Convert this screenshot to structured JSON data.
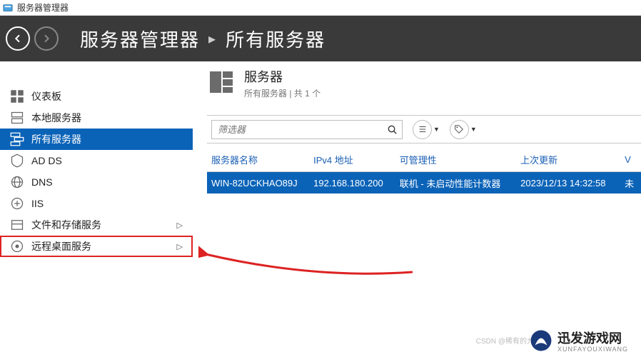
{
  "titlebar": {
    "title": "服务器管理器"
  },
  "header": {
    "breadcrumb": {
      "part1": "服务器管理器",
      "sep": "▸",
      "part2": "所有服务器"
    }
  },
  "sidebar": {
    "items": [
      {
        "label": "仪表板",
        "icon": "dashboard"
      },
      {
        "label": "本地服务器",
        "icon": "local-server"
      },
      {
        "label": "所有服务器",
        "icon": "all-servers",
        "selected": true
      },
      {
        "label": "AD DS",
        "icon": "ad-ds"
      },
      {
        "label": "DNS",
        "icon": "dns"
      },
      {
        "label": "IIS",
        "icon": "iis"
      },
      {
        "label": "文件和存储服务",
        "icon": "file-storage",
        "chevron": "▷"
      },
      {
        "label": "远程桌面服务",
        "icon": "remote-desktop",
        "chevron": "▷",
        "boxed": true
      }
    ]
  },
  "panel": {
    "title": "服务器",
    "subtitle": "所有服务器 | 共 1 个"
  },
  "toolbar": {
    "filter_placeholder": "筛选器"
  },
  "grid": {
    "headers": {
      "c1": "服务器名称",
      "c2": "IPv4 地址",
      "c3": "可管理性",
      "c4": "上次更新",
      "c5": "V"
    },
    "rows": [
      {
        "c1": "WIN-82UCKHAO89J",
        "c2": "192.168.180.200",
        "c3": "联机 - 未启动性能计数器",
        "c4": "2023/12/13 14:32:58",
        "c5": "未"
      }
    ]
  },
  "watermark": {
    "brand": "迅发游戏网",
    "sub": "XUNFAYOUXIWANG",
    "faint": "CSDN @稀有的九鸡"
  }
}
